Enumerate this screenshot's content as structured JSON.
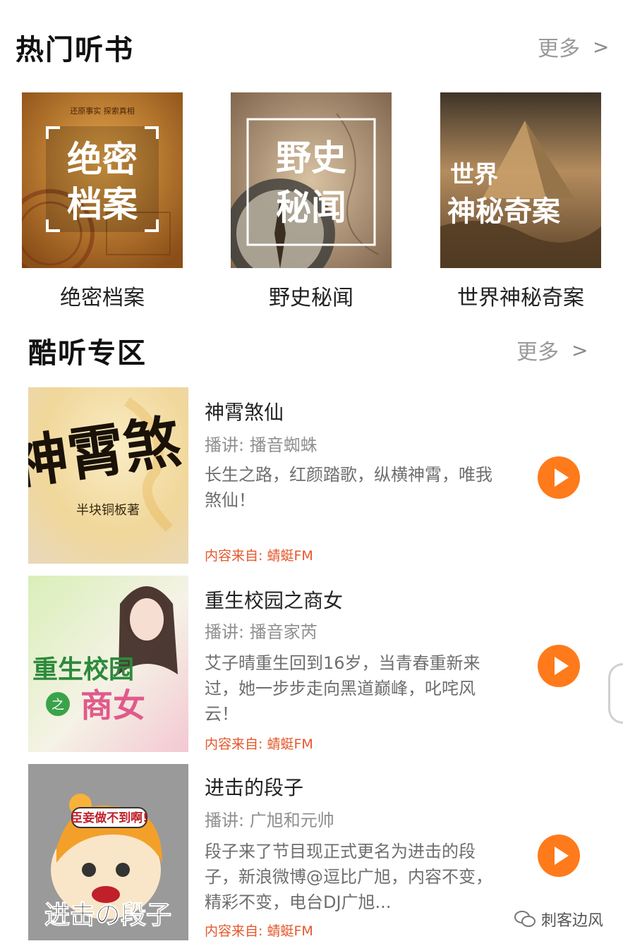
{
  "hot": {
    "title": "热门听书",
    "more_label": "更多",
    "more_chevron": ">",
    "items": [
      {
        "label": "绝密档案",
        "cover_text_1": "绝密",
        "cover_text_2": "档案",
        "cover_tag": "还原事实 探索真相",
        "colors": {
          "bg": "#c9872f",
          "dark": "#7a4313"
        }
      },
      {
        "label": "野史秘闻",
        "cover_text_1": "野史",
        "cover_text_2": "秘闻",
        "colors": {
          "bg": "#b89670",
          "dark": "#5b4838"
        }
      },
      {
        "label": "世界神秘奇案",
        "cover_text_1": "世界",
        "cover_text_2": "神秘奇案",
        "colors": {
          "bg": "#a67c4f",
          "dark": "#4d3a26"
        }
      }
    ]
  },
  "cool": {
    "title": "酷听专区",
    "more_label": "更多",
    "more_chevron": ">",
    "items": [
      {
        "title": "神霄煞仙",
        "narrator": "播讲: 播音蜘蛛",
        "description": "长生之路，红颜踏歌，纵横神霄，唯我煞仙！",
        "source": "内容来自: 蜻蜓FM",
        "cover_text": "神霄煞",
        "cover_author": "半块铜板著"
      },
      {
        "title": "重生校园之商女",
        "narrator": "播讲: 播音家芮",
        "description": "艾子晴重生回到16岁，当青春重新来过，她一步步走向黑道巅峰，叱咤风云！",
        "source": "内容来自: 蜻蜓FM",
        "cover_text_1": "重生校园",
        "cover_text_2": "之",
        "cover_text_3": "商女"
      },
      {
        "title": "进击的段子",
        "narrator": "播讲: 广旭和元帅",
        "description": "段子来了节目现正式更名为进击的段子，新浪微博@逗比广旭，内容不变，精彩不变，电台DJ广旭...",
        "source": "内容来自: 蜻蜓FM",
        "cover_bubble": "臣妾做不到啊!",
        "cover_text": "进击の段子"
      }
    ]
  },
  "watermark": {
    "text": "刺客边风"
  },
  "colors": {
    "accent": "#ff7a1a",
    "source": "#e4582c"
  }
}
